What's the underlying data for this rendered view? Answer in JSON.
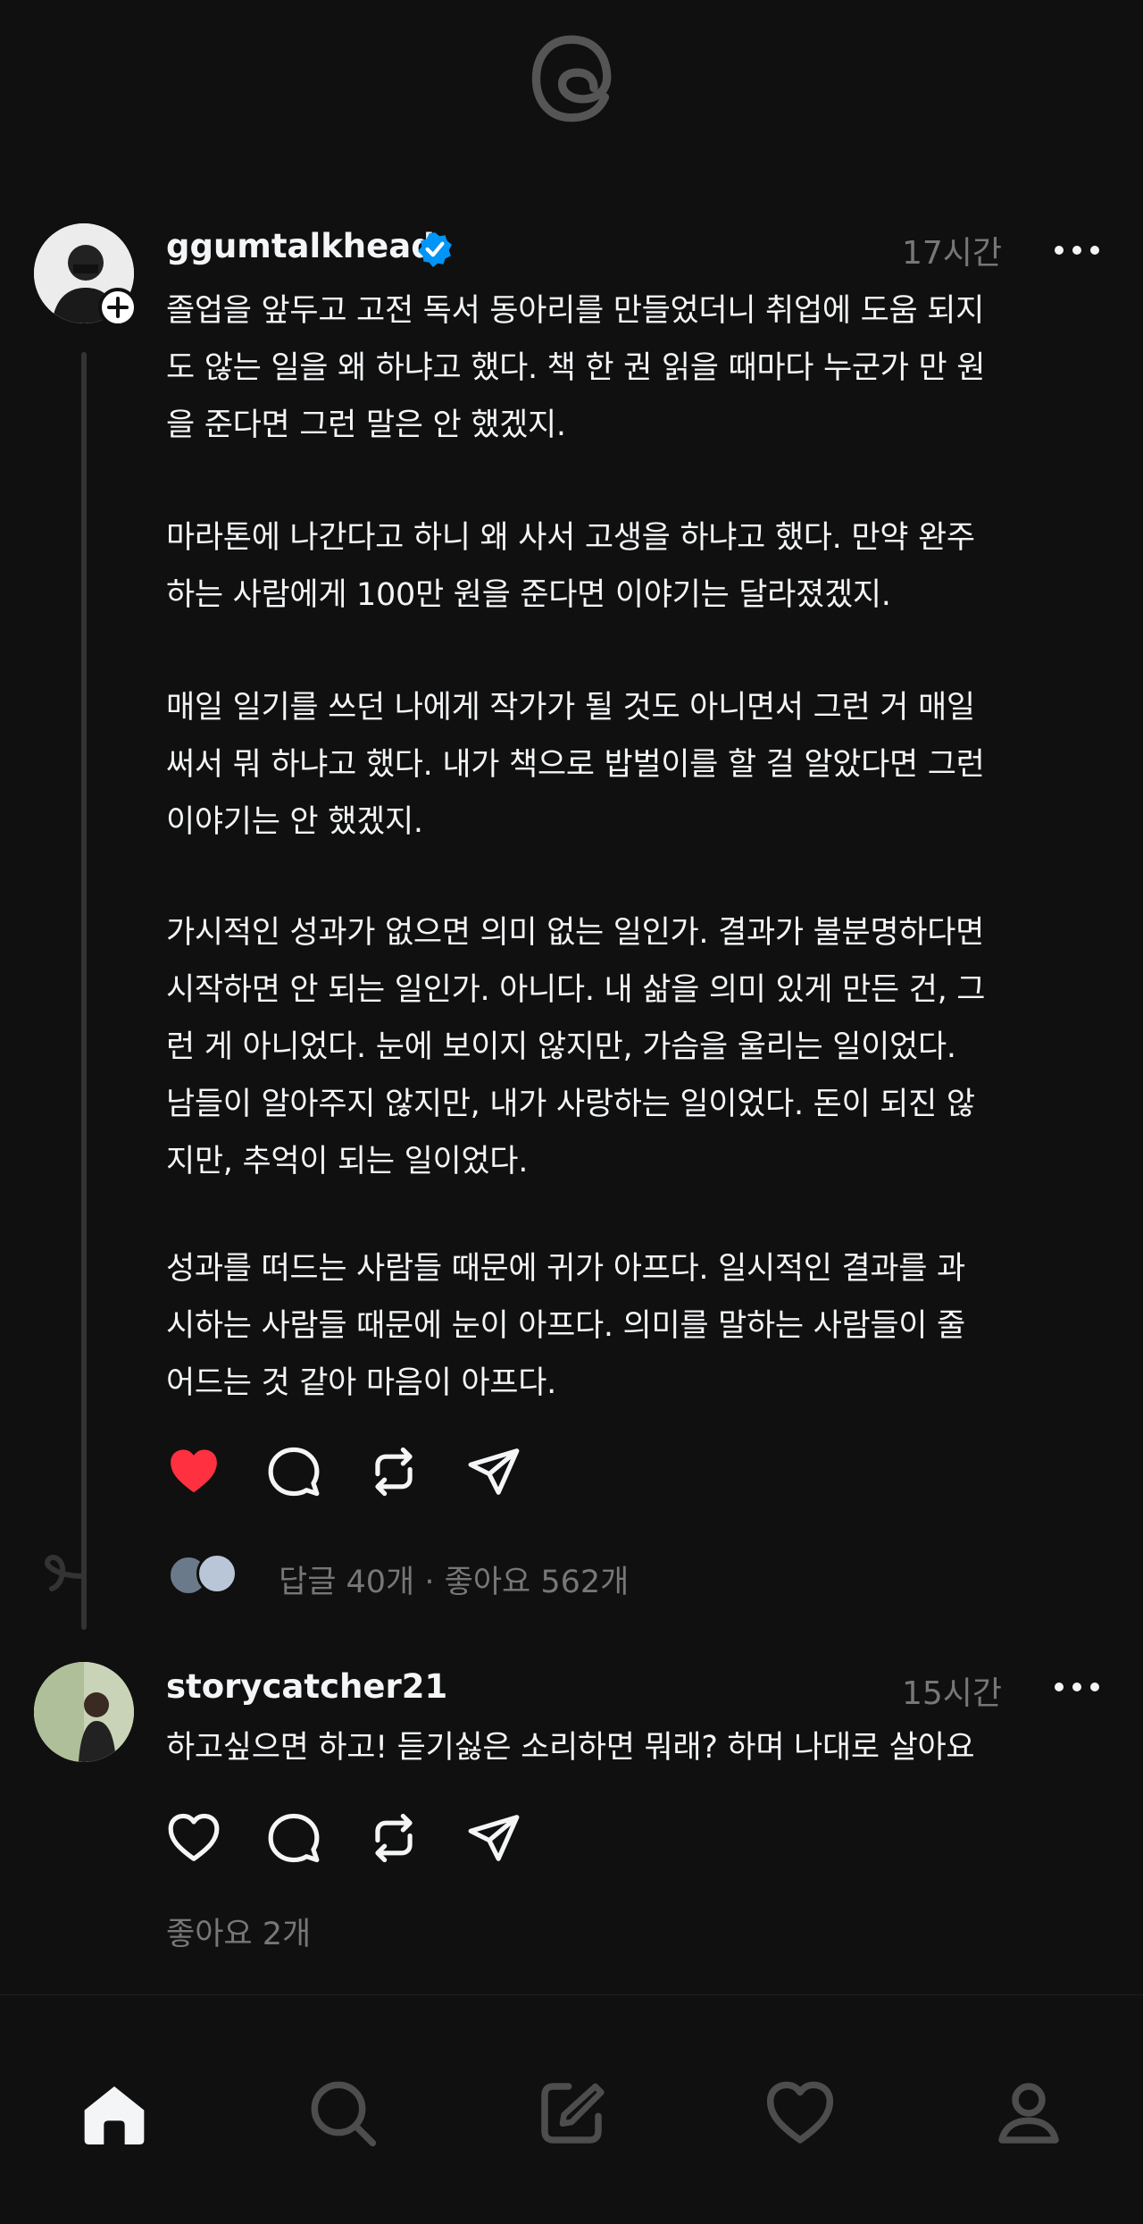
{
  "app": {
    "name": "Threads"
  },
  "post": {
    "username": "ggumtalkhead",
    "verified": true,
    "time": "17시간",
    "paragraphs": [
      "졸업을 앞두고 고전 독서 동아리를 만들었더니 취업에 도움 되지\n도 않는 일을 왜 하냐고 했다. 책 한 권 읽을 때마다 누군가 만 원\n을 준다면 그런 말은 안 했겠지.",
      "마라톤에 나간다고 하니 왜 사서 고생을 하냐고 했다. 만약 완주\n하는 사람에게 100만 원을 준다면 이야기는 달라졌겠지.",
      "매일 일기를 쓰던 나에게 작가가 될 것도 아니면서 그런 거 매일\n써서 뭐 하냐고 했다. 내가 책으로 밥벌이를 할 걸 알았다면 그런\n이야기는 안 했겠지.",
      "가시적인 성과가 없으면 의미 없는 일인가. 결과가 불분명하다면\n시작하면 안 되는 일인가. 아니다. 내 삶을 의미 있게 만든 건, 그\n런 게 아니었다. 눈에 보이지 않지만, 가슴을 울리는 일이었다.\n남들이 알아주지 않지만, 내가 사랑하는 일이었다. 돈이 되진 않\n지만, 추억이 되는 일이었다.",
      "성과를 떠드는 사람들 때문에 귀가 아프다. 일시적인 결과를 과\n시하는 사람들 때문에 눈이 아프다. 의미를 말하는 사람들이 줄\n어드는 것 같아 마음이 아프다."
    ],
    "liked": true,
    "stats": "답글 40개 · 좋아요 562개"
  },
  "reply": {
    "username": "storycatcher21",
    "time": "15시간",
    "text": "하고싶으면 하고! 듣기싫은 소리하면 뭐래? 하며 나대로 살아요",
    "liked": false,
    "stats": "좋아요 2개"
  },
  "icons": {
    "logo": "threads-logo-icon",
    "verified": "verified-badge-icon",
    "more": "more-icon",
    "like": "heart-icon",
    "comment": "comment-icon",
    "repost": "repost-icon",
    "share": "share-icon",
    "nav": [
      "home-icon",
      "search-icon",
      "compose-icon",
      "activity-icon",
      "profile-icon"
    ]
  },
  "colors": {
    "accent_like": "#ff3040",
    "verified": "#0095f6",
    "muted": "#777777",
    "background": "#101010"
  }
}
